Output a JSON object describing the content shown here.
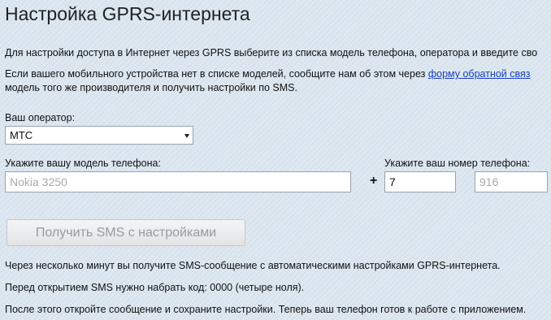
{
  "page": {
    "title": "Настройка GPRS-интернета",
    "intro": "Для настройки доступа в Интернет через GPRS выберите из списка модель телефона, оператора и введите сво",
    "missing_line1_prefix": "Если вашего мобильного устройства нет в списке моделей, сообщите нам об этом через ",
    "missing_link": "форму обратной связ",
    "missing_line2": "модель того же производителя и получить настройки по SMS."
  },
  "operator": {
    "label": "Ваш оператор:",
    "selected": "МТС"
  },
  "model": {
    "label": "Укажите вашу модель телефона:",
    "placeholder": "Nokia 3250"
  },
  "phone": {
    "label": "Укажите ваш номер телефона:",
    "plus": "+",
    "country_code": "7",
    "area_placeholder": "916"
  },
  "submit": {
    "label": "Получить SMS с настройками"
  },
  "notes": {
    "line1": "Через несколько минут вы получите SMS-сообщение с автоматическими настройками GPRS-интернета.",
    "line2": "Перед открытием SMS нужно набрать код: 0000 (четыре ноля).",
    "line3": "После этого откройте сообщение и сохраните настройки. Теперь ваш телефон готов к работе с приложением."
  }
}
